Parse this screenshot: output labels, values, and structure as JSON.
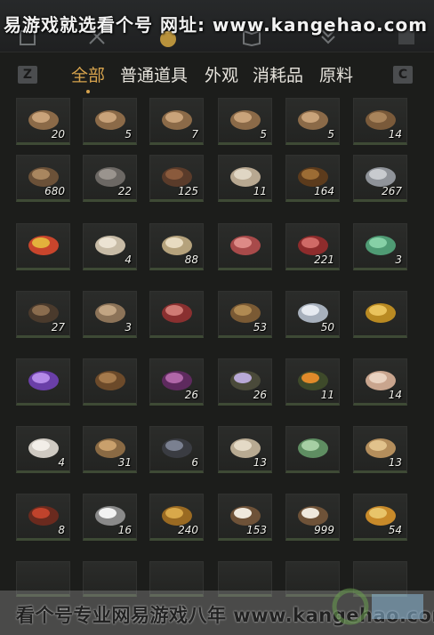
{
  "watermark_top": "易游戏就选看个号  网址: www.kangehao.com",
  "watermark_bottom": "看个号专业网易游戏八年  www.kangehao.com",
  "keys": {
    "left": "Z",
    "right": "C"
  },
  "tabs": [
    {
      "label": "全部",
      "active": true
    },
    {
      "label": "普通道具",
      "active": false
    },
    {
      "label": "外观",
      "active": false
    },
    {
      "label": "消耗品",
      "active": false
    },
    {
      "label": "原料",
      "active": false
    }
  ],
  "items": [
    {
      "name": "log-bundle",
      "count": "20"
    },
    {
      "name": "log-bundle",
      "count": "5"
    },
    {
      "name": "log-bundle",
      "count": "7"
    },
    {
      "name": "log-bundle",
      "count": "5"
    },
    {
      "name": "log-bundle",
      "count": "5"
    },
    {
      "name": "bark-bundle",
      "count": "14"
    },
    {
      "name": "wood-pile",
      "count": "680"
    },
    {
      "name": "stone",
      "count": "22"
    },
    {
      "name": "feather",
      "count": "125"
    },
    {
      "name": "shells",
      "count": "11"
    },
    {
      "name": "insect",
      "count": "164"
    },
    {
      "name": "fish",
      "count": "267"
    },
    {
      "name": "berries",
      "count": ""
    },
    {
      "name": "mushrooms",
      "count": "4"
    },
    {
      "name": "eggs",
      "count": "88"
    },
    {
      "name": "meat-chunks",
      "count": ""
    },
    {
      "name": "raw-meat",
      "count": "221"
    },
    {
      "name": "jade-stone",
      "count": "3"
    },
    {
      "name": "feathers-bundle",
      "count": "27"
    },
    {
      "name": "hide",
      "count": "3"
    },
    {
      "name": "meat-slab",
      "count": ""
    },
    {
      "name": "catfish",
      "count": "53"
    },
    {
      "name": "silver-fish",
      "count": "50"
    },
    {
      "name": "golden-carp",
      "count": ""
    },
    {
      "name": "amethyst",
      "count": ""
    },
    {
      "name": "herb-bowl",
      "count": ""
    },
    {
      "name": "purple-flower",
      "count": "26"
    },
    {
      "name": "lavender-sprig",
      "count": "26"
    },
    {
      "name": "orange-flower",
      "count": "11"
    },
    {
      "name": "fabric-pack",
      "count": "14"
    },
    {
      "name": "coral",
      "count": "4"
    },
    {
      "name": "pufferfish",
      "count": "31"
    },
    {
      "name": "dark-ore",
      "count": "6"
    },
    {
      "name": "bone-spine",
      "count": "13"
    },
    {
      "name": "melon",
      "count": ""
    },
    {
      "name": "dumplings",
      "count": "13"
    },
    {
      "name": "red-twig",
      "count": "8"
    },
    {
      "name": "white-fur",
      "count": "16"
    },
    {
      "name": "tiger-pelt",
      "count": "240"
    },
    {
      "name": "milk-bowl",
      "count": "153"
    },
    {
      "name": "milk-bowl",
      "count": "999"
    },
    {
      "name": "fruit-mix",
      "count": "54"
    }
  ]
}
